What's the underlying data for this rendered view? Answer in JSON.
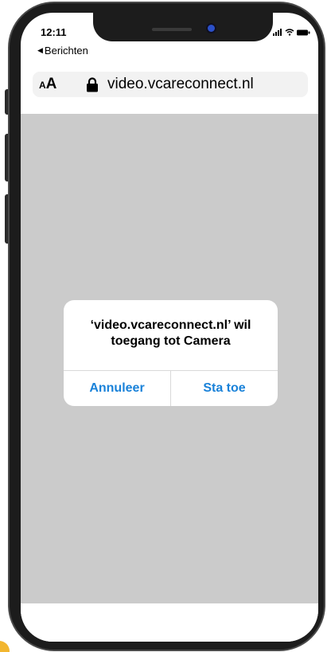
{
  "status_bar": {
    "time": "12:11",
    "back_label": "Berichten",
    "icons": [
      "signal-icon",
      "wifi-icon",
      "battery-icon"
    ]
  },
  "browser": {
    "text_size_small": "A",
    "text_size_large": "A",
    "url": "video.vcareconnect.nl",
    "lock_icon": "lock-icon"
  },
  "dialog": {
    "message_line1": "‘video.vcareconnect.nl’ wil",
    "message_line2": "toegang tot Camera",
    "cancel_label": "Annuleer",
    "allow_label": "Sta toe"
  },
  "colors": {
    "dialog_button": "#1a82d9",
    "web_overlay": "#cbcbcb",
    "phone_frame": "#1c1c1c"
  }
}
